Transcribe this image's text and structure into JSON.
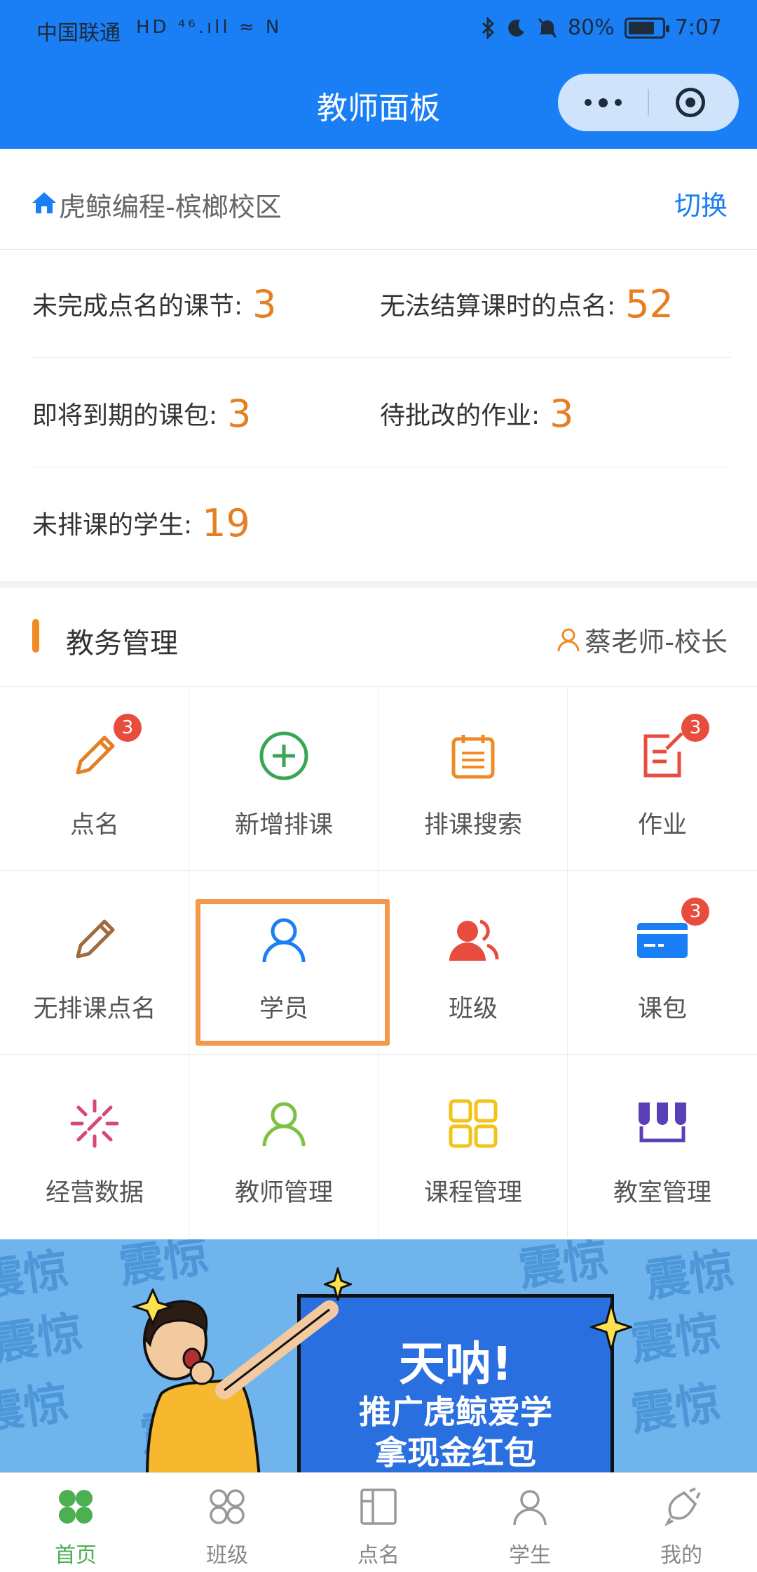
{
  "status_bar": {
    "carrier": "中国联通",
    "signal_text": "HD ⁴⁶.ıll ≈ N",
    "battery_percent": "80%",
    "battery_level": 0.8,
    "time": "7:07"
  },
  "nav": {
    "title": "教师面板"
  },
  "campus": {
    "name": "虎鲸编程-槟榔校区",
    "switch_label": "切换"
  },
  "stats": [
    {
      "label": "未完成点名的课节:",
      "value": "3"
    },
    {
      "label": "无法结算课时的点名:",
      "value": "52"
    },
    {
      "label": "即将到期的课包:",
      "value": "3"
    },
    {
      "label": "待批改的作业:",
      "value": "3"
    },
    {
      "label": "未排课的学生:",
      "value": "19"
    }
  ],
  "section": {
    "title": "教务管理",
    "user": "蔡老师-校长"
  },
  "grid": [
    {
      "label": "点名",
      "icon": "pencil-icon",
      "badge": "3"
    },
    {
      "label": "新增排课",
      "icon": "add-circle-icon",
      "badge": ""
    },
    {
      "label": "排课搜索",
      "icon": "calendar-list-icon",
      "badge": ""
    },
    {
      "label": "作业",
      "icon": "homework-edit-icon",
      "badge": "3"
    },
    {
      "label": "无排课点名",
      "icon": "pencil-outline-icon",
      "badge": ""
    },
    {
      "label": "学员",
      "icon": "person-icon",
      "badge": ""
    },
    {
      "label": "班级",
      "icon": "group-icon",
      "badge": ""
    },
    {
      "label": "课包",
      "icon": "card-icon",
      "badge": "3"
    },
    {
      "label": "经营数据",
      "icon": "sparkle-icon",
      "badge": ""
    },
    {
      "label": "教师管理",
      "icon": "teacher-icon",
      "badge": ""
    },
    {
      "label": "课程管理",
      "icon": "grid-icon",
      "badge": ""
    },
    {
      "label": "教室管理",
      "icon": "classroom-icon",
      "badge": ""
    }
  ],
  "banner": {
    "watermark": "震惊",
    "headline": "天呐!",
    "line1": "推广虎鲸爱学",
    "line2": "拿现金红包"
  },
  "tabbar": [
    {
      "label": "首页",
      "icon": "home-icon",
      "active": true
    },
    {
      "label": "班级",
      "icon": "class-icon",
      "active": false
    },
    {
      "label": "点名",
      "icon": "rollcall-icon",
      "active": false
    },
    {
      "label": "学生",
      "icon": "student-icon",
      "active": false
    },
    {
      "label": "我的",
      "icon": "profile-icon",
      "active": false
    }
  ],
  "colors": {
    "primary": "#1a7ef5",
    "accent_number": "#e67e22",
    "badge": "#e74c3c",
    "tab_active": "#4caf50"
  }
}
